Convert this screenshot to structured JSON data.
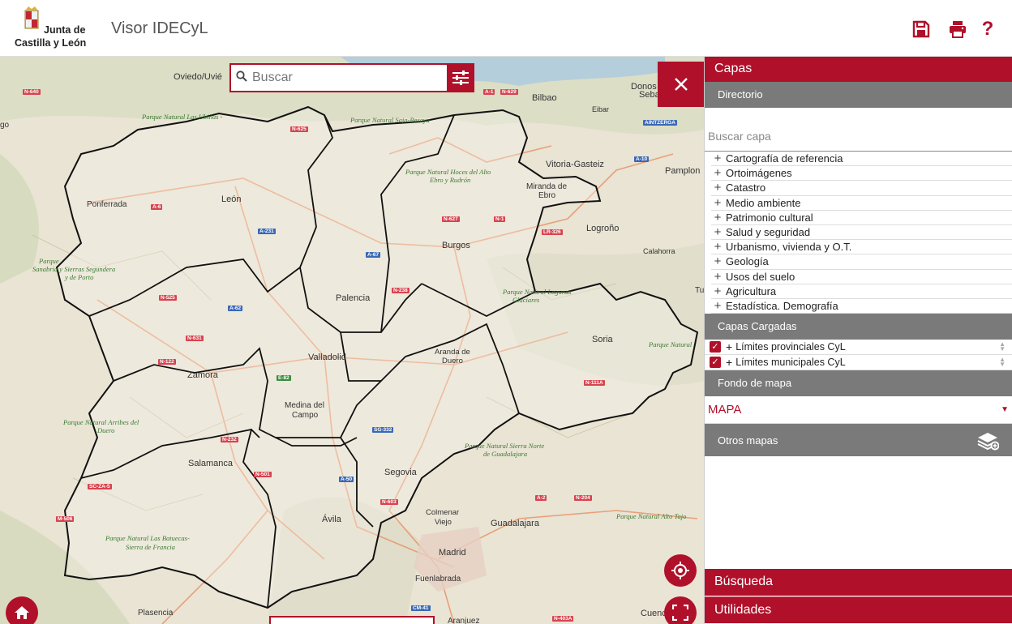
{
  "header": {
    "logo_line1": "Junta de",
    "logo_line2": "Castilla y León",
    "app_title": "Visor IDECyL",
    "help_label": "?"
  },
  "map": {
    "search_placeholder": "Buscar",
    "cities": [
      {
        "name": "Oviedo/Uvié"
      },
      {
        "name": "Bilbao"
      },
      {
        "name": "Donos"
      },
      {
        "name": "Seba"
      },
      {
        "name": "Eibar"
      },
      {
        "name": "Vitoria-Gasteiz"
      },
      {
        "name": "Pamplon"
      },
      {
        "name": "Miranda de"
      },
      {
        "name": "Ebro"
      },
      {
        "name": "Logroño"
      },
      {
        "name": "Calahorra"
      },
      {
        "name": "Ponferrada"
      },
      {
        "name": "León"
      },
      {
        "name": "Burgos"
      },
      {
        "name": "Palencia"
      },
      {
        "name": "Soria"
      },
      {
        "name": "Valladolid"
      },
      {
        "name": "Aranda de"
      },
      {
        "name": "Duero"
      },
      {
        "name": "Zamora"
      },
      {
        "name": "Medina del"
      },
      {
        "name": "Campo"
      },
      {
        "name": "Salamanca"
      },
      {
        "name": "Segovia"
      },
      {
        "name": "Colmenar"
      },
      {
        "name": "Viejo"
      },
      {
        "name": "Guadalajara"
      },
      {
        "name": "Ávila"
      },
      {
        "name": "Madrid"
      },
      {
        "name": "Fuenlabrada"
      },
      {
        "name": "Plasencia"
      },
      {
        "name": "Aranjuez"
      },
      {
        "name": "Cuenca"
      },
      {
        "name": "Tu"
      },
      {
        "name": "go"
      }
    ],
    "parks": [
      {
        "name": "Parque Natural Las Ubiñas -"
      },
      {
        "name": "Parque Natural Saja-Besaya"
      },
      {
        "name": "Parque Natural Hoces del Alto"
      },
      {
        "name": "Ebro y Rudrón"
      },
      {
        "name": "Parque"
      },
      {
        "name": "Sanabria y Sierras Segundera"
      },
      {
        "name": "y de Porto"
      },
      {
        "name": "Parque Natural Lagunas"
      },
      {
        "name": "Glaciares"
      },
      {
        "name": "Parque Natural"
      },
      {
        "name": "Parque Natural Arribes del"
      },
      {
        "name": "Duero"
      },
      {
        "name": "Parque Natural Sierra Norte"
      },
      {
        "name": "de Guadalajara"
      },
      {
        "name": "Parque Natural Alto Tajo"
      },
      {
        "name": "Parque Natural Las Batuecas-"
      },
      {
        "name": "Sierra de Francia"
      }
    ],
    "roads": [
      {
        "code": "N-640"
      },
      {
        "code": "N-625"
      },
      {
        "code": "N-629"
      },
      {
        "code": "A-6"
      },
      {
        "code": "A-231"
      },
      {
        "code": "A-67"
      },
      {
        "code": "N-627"
      },
      {
        "code": "N-1"
      },
      {
        "code": "LR-326"
      },
      {
        "code": "N-525"
      },
      {
        "code": "A-62"
      },
      {
        "code": "N-631"
      },
      {
        "code": "N-122"
      },
      {
        "code": "E-82"
      },
      {
        "code": "N-111A"
      },
      {
        "code": "SG-332"
      },
      {
        "code": "N-501"
      },
      {
        "code": "A-50"
      },
      {
        "code": "N-603"
      },
      {
        "code": "A-2"
      },
      {
        "code": "N-204"
      },
      {
        "code": "CM-41"
      },
      {
        "code": "N-403A"
      },
      {
        "code": "A-1"
      },
      {
        "code": "AINTZERGA"
      },
      {
        "code": "A-10"
      },
      {
        "code": "SC-ZA-5"
      },
      {
        "code": "M-506"
      },
      {
        "code": "N-232"
      },
      {
        "code": "N-238"
      }
    ]
  },
  "panel": {
    "title": "Capas",
    "directorio_header": "Directorio",
    "layer_search_placeholder": "Buscar capa",
    "categories": [
      {
        "label": "Cartografía de referencia"
      },
      {
        "label": "Ortoimágenes"
      },
      {
        "label": "Catastro"
      },
      {
        "label": "Medio ambiente"
      },
      {
        "label": "Patrimonio cultural"
      },
      {
        "label": "Salud y seguridad"
      },
      {
        "label": "Urbanismo, vivienda y O.T."
      },
      {
        "label": "Geología"
      },
      {
        "label": "Usos del suelo"
      },
      {
        "label": "Agricultura"
      },
      {
        "label": "Estadística. Demografía"
      }
    ],
    "loaded_header": "Capas Cargadas",
    "loaded_layers": [
      {
        "label": "Límites provinciales CyL",
        "checked": true
      },
      {
        "label": "Límites municipales CyL",
        "checked": true
      }
    ],
    "fondo_header": "Fondo de mapa",
    "fondo_value": "MAPA",
    "otros_label": "Otros mapas",
    "busqueda_label": "Búsqueda",
    "utilidades_label": "Utilidades"
  },
  "colors": {
    "accent": "#b0102a",
    "section_gray": "#7a7a7a",
    "map_base": "#e9e4d4"
  }
}
